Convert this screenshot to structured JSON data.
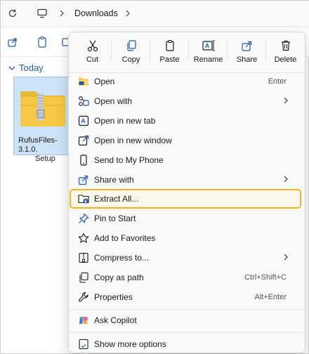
{
  "address": {
    "folder": "Downloads"
  },
  "group": {
    "label": "Today"
  },
  "file": {
    "name_line1": "RufusFiles-3.1.0.",
    "name_line2": "Setup"
  },
  "quick_actions": [
    {
      "label": "Cut",
      "icon": "scissors-icon"
    },
    {
      "label": "Copy",
      "icon": "copy-icon"
    },
    {
      "label": "Paste",
      "icon": "paste-icon"
    },
    {
      "label": "Rename",
      "icon": "rename-icon"
    },
    {
      "label": "Share",
      "icon": "share-icon"
    },
    {
      "label": "Delete",
      "icon": "trash-icon"
    }
  ],
  "menu": {
    "open": {
      "label": "Open",
      "shortcut": "Enter"
    },
    "open_with": {
      "label": "Open with"
    },
    "open_new_tab": {
      "label": "Open in new tab"
    },
    "open_new_window": {
      "label": "Open in new window"
    },
    "send_to_phone": {
      "label": "Send to My Phone"
    },
    "share_with": {
      "label": "Share with"
    },
    "extract_all": {
      "label": "Extract All..."
    },
    "pin_to_start": {
      "label": "Pin to Start"
    },
    "add_favorites": {
      "label": "Add to Favorites"
    },
    "compress_to": {
      "label": "Compress to..."
    },
    "copy_as_path": {
      "label": "Copy as path",
      "shortcut": "Ctrl+Shift+C"
    },
    "properties": {
      "label": "Properties",
      "shortcut": "Alt+Enter"
    },
    "ask_copilot": {
      "label": "Ask Copilot"
    },
    "show_more": {
      "label": "Show more options"
    }
  },
  "colors": {
    "highlight_border": "#f2b424",
    "accent_blue": "#1f5aa6",
    "folder_yellow": "#f6c845"
  }
}
